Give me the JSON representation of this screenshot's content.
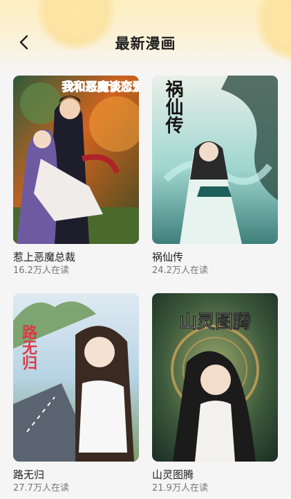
{
  "header": {
    "title": "最新漫画",
    "back_icon": "chevron-left-icon"
  },
  "comics": [
    {
      "title": "惹上恶魔总裁",
      "readers": "16.2万人在读",
      "cover_text": "我和恶魔谈恋爱"
    },
    {
      "title": "祸仙传",
      "readers": "24.2万人在读",
      "cover_text": "祸仙传"
    },
    {
      "title": "路无归",
      "readers": "27.7万人在读",
      "cover_text": "路无归"
    },
    {
      "title": "山灵图腾",
      "readers": "21.9万人在读",
      "cover_text": "山灵图腾"
    }
  ],
  "colors": {
    "header_gradient_top": "#fcefc0",
    "background": "#f5f5f5",
    "title_text": "#1f1f1f",
    "meta_text": "#757575"
  }
}
